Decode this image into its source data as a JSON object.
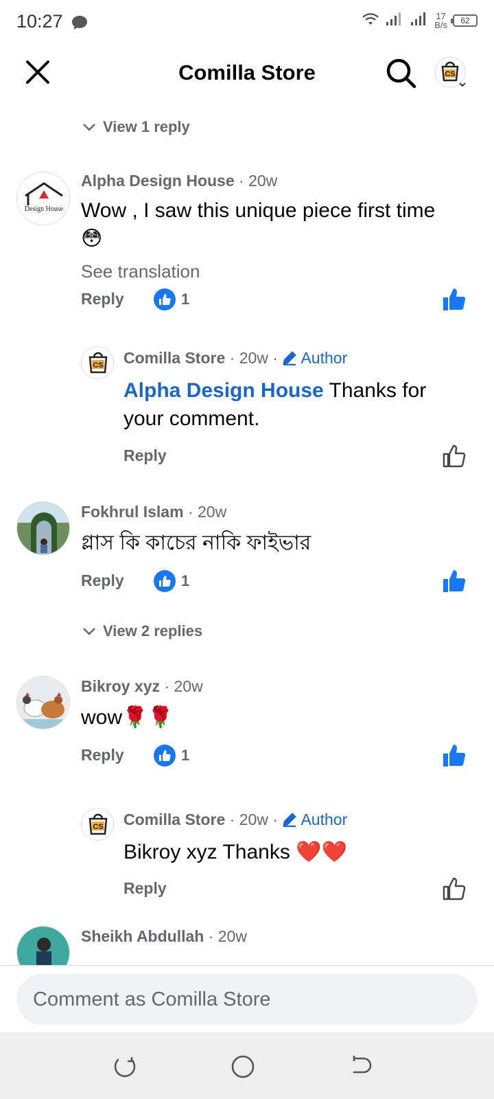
{
  "status_bar": {
    "time": "10:27",
    "net_speed_value": "17",
    "net_speed_unit": "B/s",
    "battery": "62"
  },
  "header": {
    "title": "Comilla Store"
  },
  "colors": {
    "accent_blue": "#1877f2",
    "author_blue": "#1b66c9",
    "meta_gray": "#65676b"
  },
  "comments": [
    {
      "view_replies": "View 1 reply"
    },
    {
      "author": "Alpha Design House",
      "time": "· 20w",
      "text": "Wow , I saw this unique piece first time",
      "emoji": "😳",
      "see_translation": "See translation",
      "reply_label": "Reply",
      "like_count": "1",
      "avatar_icon": "alpha-design-house-logo"
    },
    {
      "author": "Comilla Store",
      "time": "· 20w ·",
      "badge": "Author",
      "mention": "Alpha Design House",
      "text": " Thanks for your comment.",
      "reply_label": "Reply",
      "avatar_icon": "comilla-store-logo"
    },
    {
      "author": "Fokhrul Islam",
      "time": "· 20w",
      "text": "গ্লাস কি কাচের নাকি ফাইভার",
      "reply_label": "Reply",
      "like_count": "1",
      "view_replies": "View 2 replies"
    },
    {
      "author": "Bikroy xyz",
      "time": "· 20w",
      "text": "wow🌹🌹",
      "reply_label": "Reply",
      "like_count": "1"
    },
    {
      "author": "Comilla Store",
      "time": "· 20w ·",
      "badge": "Author",
      "text": "Bikroy xyz Thanks ❤️❤️",
      "reply_label": "Reply"
    },
    {
      "author": "Sheikh Abdullah",
      "time": "· 20w"
    }
  ],
  "composer": {
    "placeholder": "Comment as Comilla Store"
  }
}
